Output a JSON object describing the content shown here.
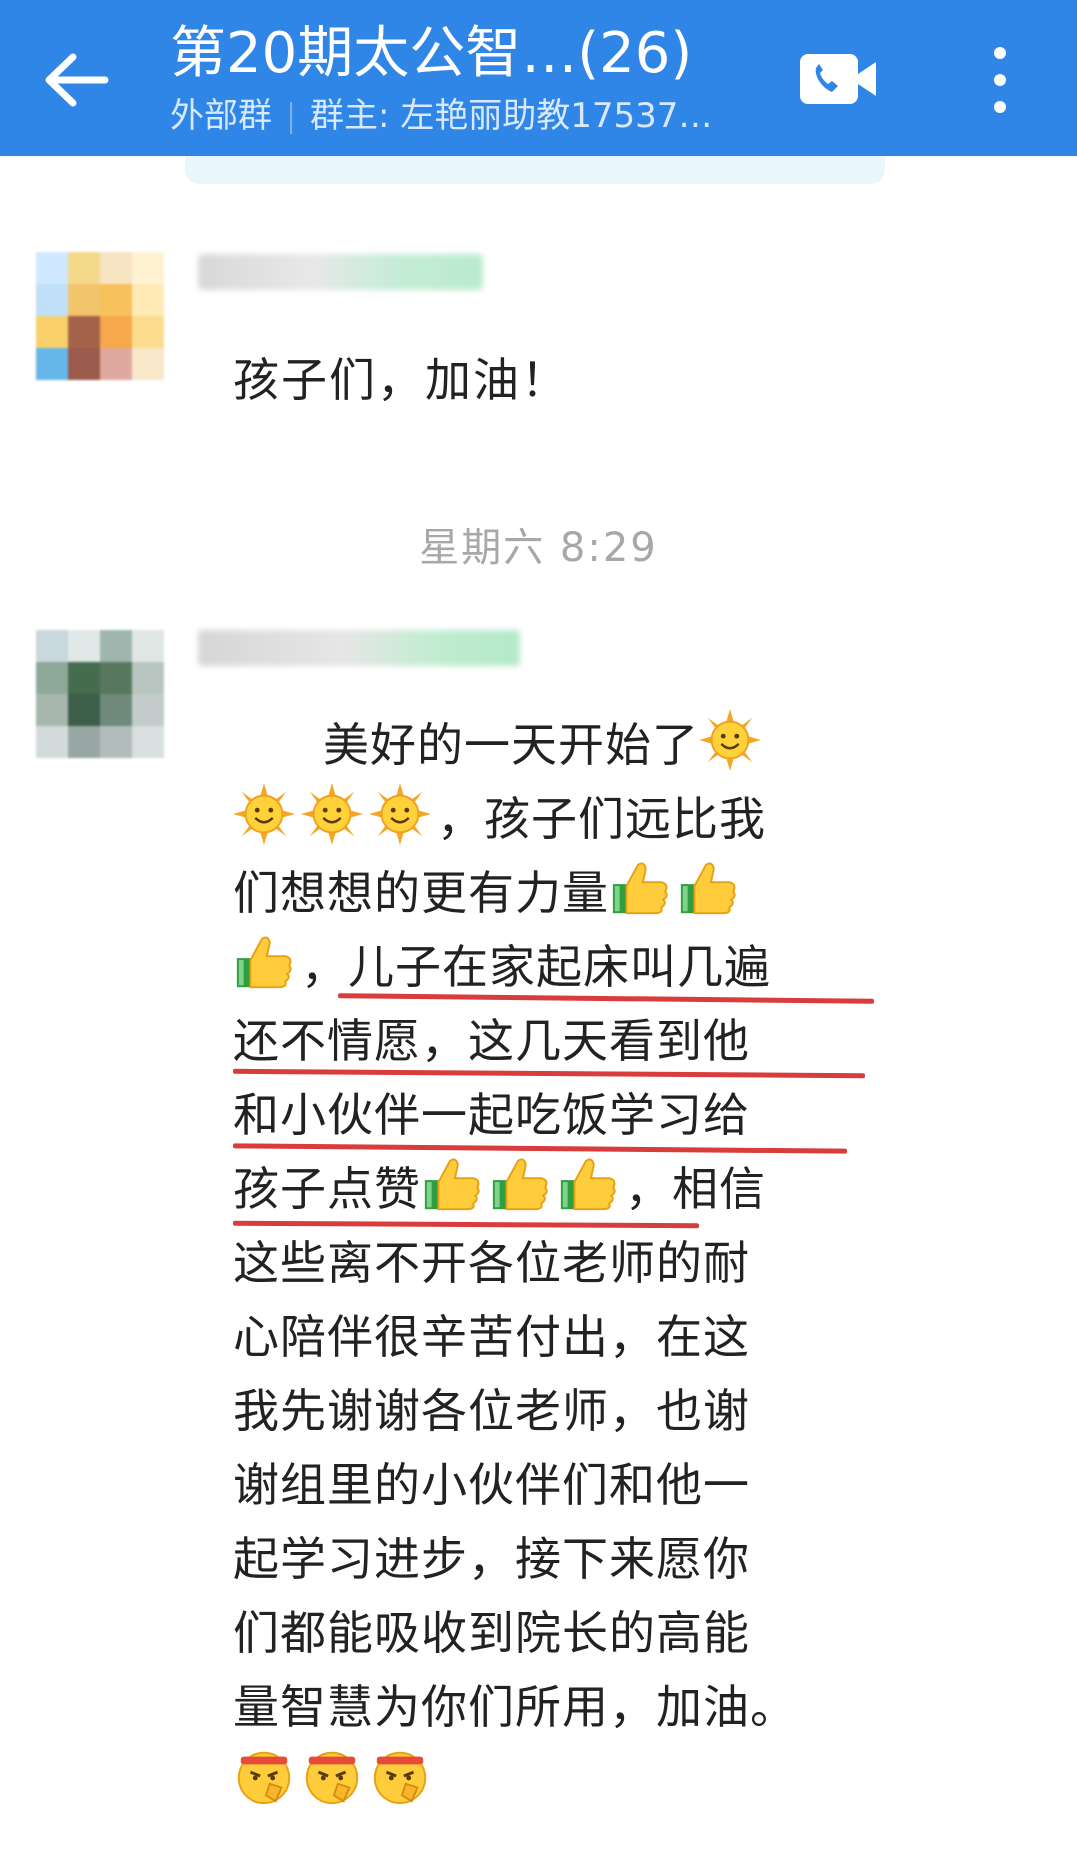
{
  "header": {
    "title": "第20期太公智…(26)",
    "subtitle_tag": "外部群",
    "subtitle_owner": "群主: 左艳丽助教17537…",
    "bg_color": "#2f86e6"
  },
  "icons": {
    "back": "arrow-left-icon",
    "video": "video-call-icon",
    "more": "more-vertical-icon"
  },
  "messages": [
    {
      "text": "孩子们，加油！"
    },
    {
      "timestamp": "星期六  8:29"
    },
    {
      "lines": [
        "美好的一天开始了",
        "，孩子们远比我",
        "们想想的更有力量",
        "，儿子在家起床叫几遍",
        "还不情愿，这几天看到他",
        "和小伙伴一起吃饭学习给",
        "孩子点赞",
        "，相信",
        "这些离不开各位老师的耐",
        "心陪伴很辛苦付出，在这",
        "我先谢谢各位老师，也谢",
        "谢组里的小伙伴们和他一",
        "起学习进步，接下来愿你",
        "们都能吸收到院长的高能",
        "量智慧为你们所用，加油。"
      ],
      "emoji_names": [
        "sun-emoji",
        "thumbs-up-emoji",
        "salute-emoji"
      ]
    }
  ]
}
